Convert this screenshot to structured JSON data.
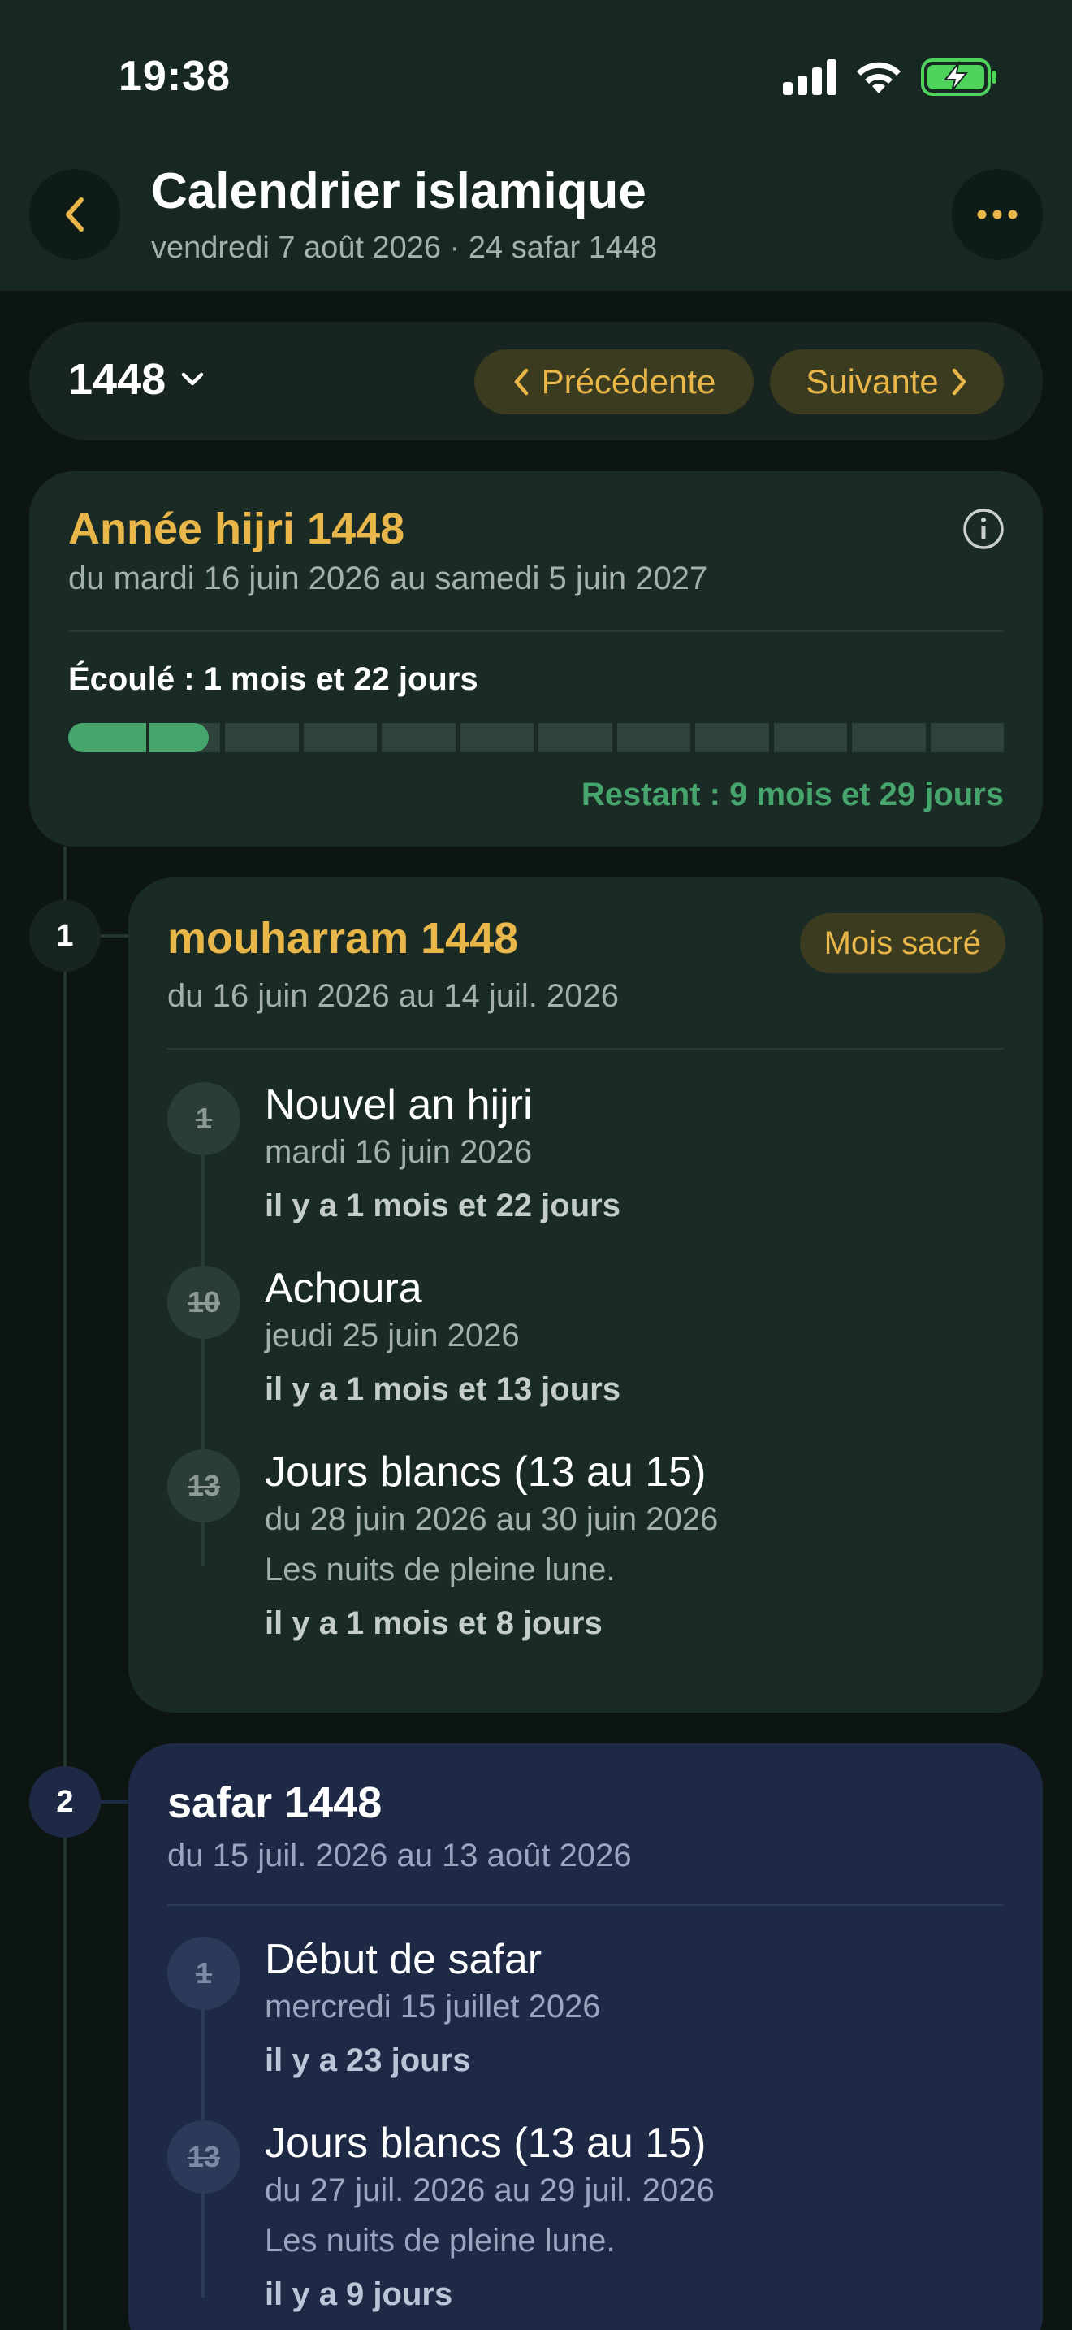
{
  "status_bar": {
    "time": "19:38"
  },
  "nav": {
    "title": "Calendrier islamique",
    "subtitle": "vendredi 7 août 2026 · 24 safar 1448"
  },
  "year_selector": {
    "year": "1448",
    "prev_label": "Précédente",
    "next_label": "Suivante"
  },
  "year_card": {
    "title": "Année hijri 1448",
    "range": "du mardi 16 juin 2026 au samedi 5 juin 2027",
    "elapsed": "Écoulé : 1 mois et 22 jours",
    "remaining": "Restant : 9 mois et 29 jours",
    "progress_months_total": 12,
    "progress_fraction": 0.15
  },
  "months": [
    {
      "number": "1",
      "title": "mouharram 1448",
      "range": "du 16 juin 2026 au 14 juil. 2026",
      "badge": "Mois sacré",
      "events": [
        {
          "day": "1",
          "title": "Nouvel an hijri",
          "date": "mardi 16 juin 2026",
          "ago": "il y a 1 mois et 22 jours"
        },
        {
          "day": "10",
          "title": "Achoura",
          "date": "jeudi 25 juin 2026",
          "ago": "il y a 1 mois et 13 jours"
        },
        {
          "day": "13",
          "title": "Jours blancs (13 au 15)",
          "date": "du 28 juin 2026 au 30 juin 2026",
          "note": "Les nuits de pleine lune.",
          "ago": "il y a 1 mois et 8 jours"
        }
      ]
    },
    {
      "number": "2",
      "title": "safar 1448",
      "range": "du 15 juil. 2026 au 13 août 2026",
      "events": [
        {
          "day": "1",
          "title": "Début de safar",
          "date": "mercredi 15 juillet 2026",
          "ago": "il y a 23 jours"
        },
        {
          "day": "13",
          "title": "Jours blancs (13 au 15)",
          "date": "du 27 juil. 2026 au 29 juil. 2026",
          "note": "Les nuits de pleine lune.",
          "ago": "il y a 9 jours"
        }
      ]
    }
  ],
  "colors": {
    "accent_gold": "#e9b64a",
    "accent_green": "#46a56c",
    "current_month_bg": "#1e2a45",
    "card_bg": "#1a2b25"
  }
}
